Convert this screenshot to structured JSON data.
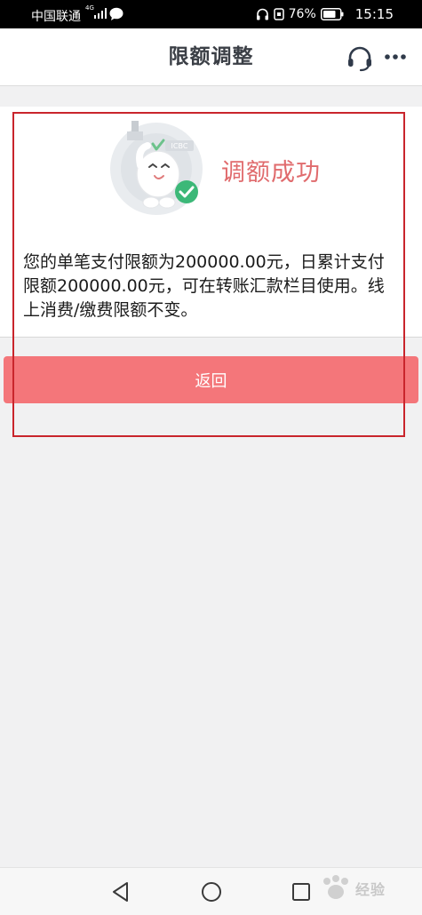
{
  "status_bar": {
    "carrier": "中国联通",
    "network": "4G",
    "battery_percent": "76%",
    "time": "15:15"
  },
  "header": {
    "title": "限额调整",
    "icons": [
      "headset-icon",
      "more-dots-icon"
    ]
  },
  "result": {
    "title": "调额成功",
    "mascot_badge": "ICBC",
    "description": "您的单笔支付限额为200000.00元，日累计支付限额200000.00元，可在转账汇款栏目使用。线上消费/缴费限额不变。"
  },
  "actions": {
    "back_label": "返回"
  },
  "nav_bar": {
    "icons": [
      "back-triangle-icon",
      "home-circle-icon",
      "recents-square-icon"
    ]
  },
  "watermark": {
    "text": "经验"
  },
  "colors": {
    "accent": "#f4767a",
    "success_title": "#e06b6d",
    "annotation": "#c9252c",
    "check_green": "#3cb878"
  }
}
